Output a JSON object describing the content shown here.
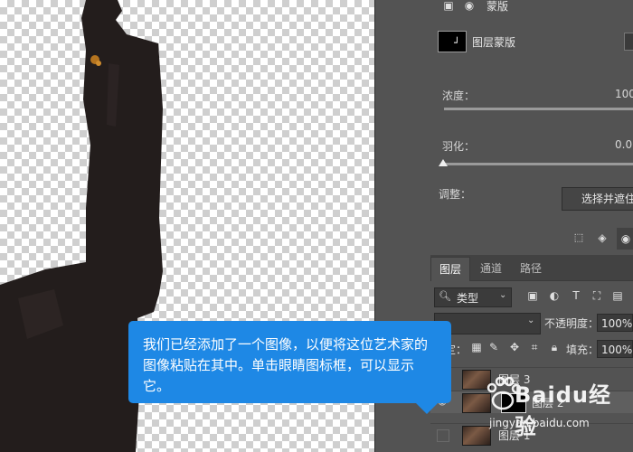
{
  "canvas": {
    "checker_light": "#ffffff",
    "checker_dark": "#cfcfcf",
    "subject_color": "#231d1c"
  },
  "properties": {
    "mask_section_label": "蒙版",
    "layer_mask_label": "图层蒙版",
    "density_label": "浓度：",
    "density_value": "100",
    "feather_label": "羽化：",
    "feather_value": "0.0",
    "adjust_label": "调整：",
    "select_mask_button": "选择并遮住"
  },
  "layers_panel": {
    "tabs": [
      "图层",
      "通道",
      "路径"
    ],
    "active_tab": 0,
    "filter_kind": "类型",
    "opacity_label": "不透明度：",
    "opacity_value": "100%",
    "lock_label": "锁定：",
    "fill_label": "填充：",
    "fill_value": "100%",
    "layers": [
      {
        "name": "图层 3",
        "visible": false
      },
      {
        "name": "图层 2",
        "visible": true
      },
      {
        "name": "图层 1",
        "visible": false
      }
    ]
  },
  "tooltip": {
    "text": "我们已经添加了一个图像，以便将这位艺术家的图像粘贴在其中。单击眼睛图标框，可以显示它。"
  },
  "watermark": {
    "brand": "Baidu经验",
    "url": "jingyan.baidu.com"
  },
  "colors": {
    "panel_bg": "#535353",
    "tab_bar_bg": "#424242",
    "tooltip_bg": "#1e88e5"
  }
}
